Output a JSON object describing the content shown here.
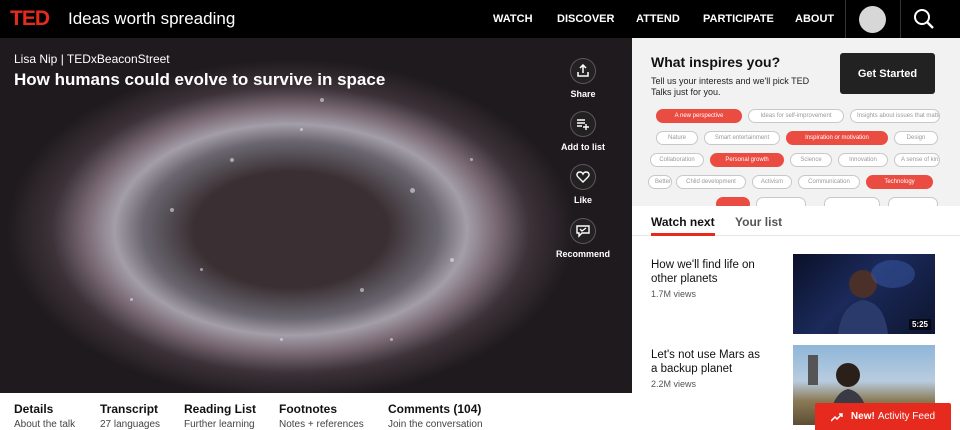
{
  "header": {
    "logo": "TED",
    "tagline": "Ideas worth spreading",
    "nav": [
      "WATCH",
      "DISCOVER",
      "ATTEND",
      "PARTICIPATE",
      "ABOUT"
    ]
  },
  "video": {
    "speaker": "Lisa Nip | TEDxBeaconStreet",
    "title": "How humans could evolve to survive in space",
    "actions": [
      "Share",
      "Add to list",
      "Like",
      "Recommend"
    ]
  },
  "bottom_tabs": [
    {
      "title": "Details",
      "sub": "About the talk"
    },
    {
      "title": "Transcript",
      "sub": "27 languages"
    },
    {
      "title": "Reading List",
      "sub": "Further learning"
    },
    {
      "title": "Footnotes",
      "sub": "Notes + references"
    },
    {
      "title": "Comments (104)",
      "sub": "Join the conversation"
    }
  ],
  "inspire": {
    "title": "What inspires you?",
    "subtitle": "Tell us your interests and we'll pick TED Talks just for you.",
    "button": "Get Started",
    "pills": [
      {
        "label": "A new perspective",
        "on": true
      },
      {
        "label": "Ideas for self-improvement",
        "on": false
      },
      {
        "label": "Insights about issues that matter",
        "on": false
      },
      {
        "label": "Nature",
        "on": false
      },
      {
        "label": "Smart entertainment",
        "on": false
      },
      {
        "label": "Inspiration or motivation",
        "on": true
      },
      {
        "label": "Design",
        "on": false
      },
      {
        "label": "Collaboration",
        "on": false
      },
      {
        "label": "Personal growth",
        "on": true
      },
      {
        "label": "Science",
        "on": false
      },
      {
        "label": "Innovation",
        "on": false
      },
      {
        "label": "A sense of kinship",
        "on": false
      },
      {
        "label": "Better",
        "on": false
      },
      {
        "label": "Child development",
        "on": false
      },
      {
        "label": "Activism",
        "on": false
      },
      {
        "label": "Communication",
        "on": false
      },
      {
        "label": "Technology",
        "on": true
      }
    ]
  },
  "watch": {
    "tabs": [
      "Watch next",
      "Your list"
    ],
    "talks": [
      {
        "title": "How we'll find life on other planets",
        "views": "1.7M views",
        "duration": "5:25"
      },
      {
        "title": "Let's not use Mars as a backup planet",
        "views": "2.2M views",
        "duration": ""
      }
    ]
  },
  "feed": {
    "new": "New!",
    "label": "Activity Feed"
  },
  "colors": {
    "ted_red": "#e62b1e",
    "pill_red": "#eb4c42"
  }
}
